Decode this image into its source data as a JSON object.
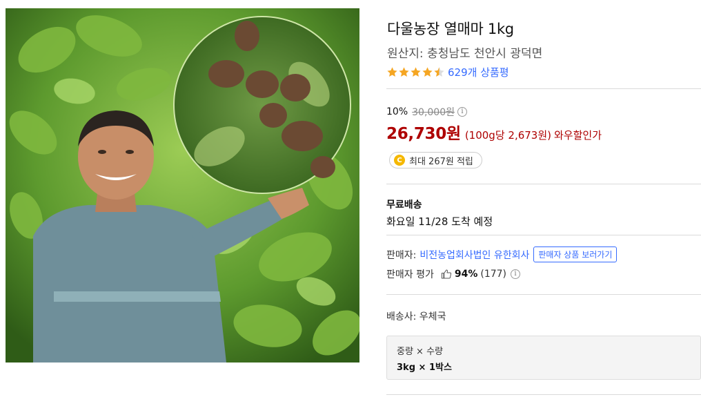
{
  "product": {
    "title": "다울농장 열매마 1kg",
    "origin": "원산지: 충청남도 천안시 광덕면",
    "rating_value": 4.5,
    "review_count": "629개 상품평"
  },
  "price": {
    "discount": "10%",
    "original": "30,000원",
    "info_glyph": "i",
    "sale": "26,730원",
    "unit_price": "(100g당 2,673원)",
    "wow_label": "와우할인가"
  },
  "points": {
    "coin_letter": "C",
    "label": "최대 267원 적립"
  },
  "shipping": {
    "free_label": "무료배송",
    "arrival": "화요일 11/28 도착 예정"
  },
  "seller": {
    "label": "판매자:",
    "name": "비전농업회사법인 유한회사",
    "view_button": "판매자 상품 보러가기",
    "rating_label": "판매자 평가",
    "rating_percent": "94%",
    "rating_count": "(177)",
    "info_glyph": "i"
  },
  "carrier": "배송사: 우체국",
  "option": {
    "title": "중량 × 수량",
    "value": "3kg × 1박스"
  },
  "colors": {
    "price_red": "#ae0000",
    "link_blue": "#346aff",
    "star_gold": "#f5a623"
  },
  "icons": [
    "star-icon",
    "info-icon",
    "coin-icon",
    "thumbs-up-icon"
  ]
}
